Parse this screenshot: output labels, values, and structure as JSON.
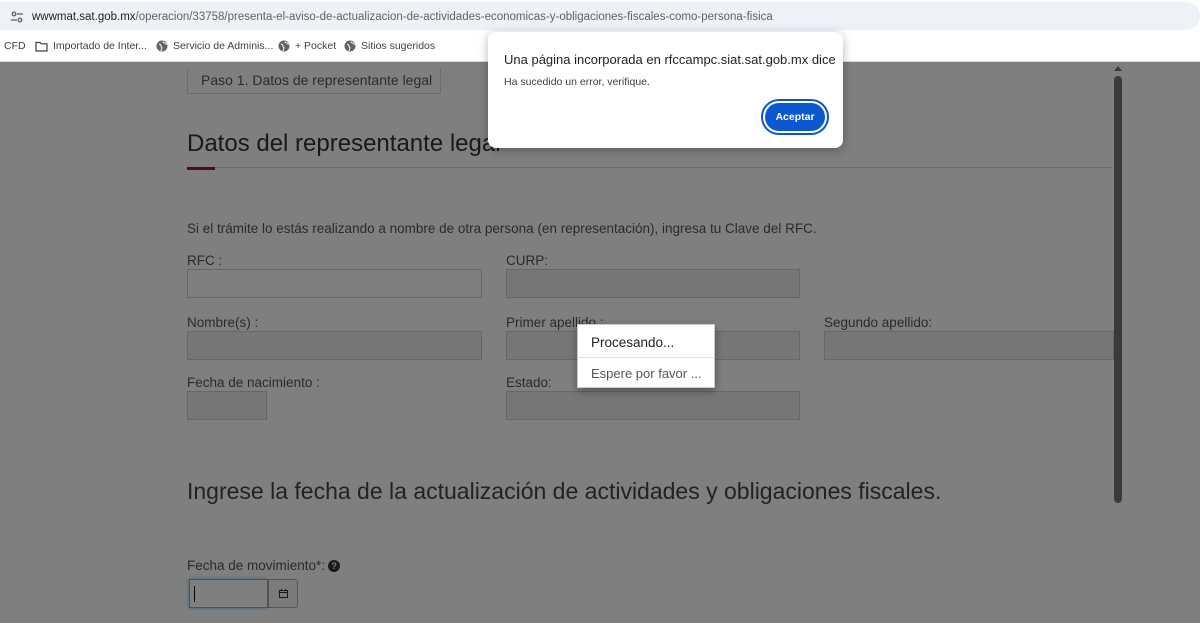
{
  "browser": {
    "url_domain": "wwwmat.sat.gob.mx",
    "url_path": "/operacion/33758/presenta-el-aviso-de-actualizacion-de-actividades-economicas-y-obligaciones-fiscales-como-persona-fisica",
    "bookmarks": [
      {
        "label": "CFD",
        "icon": "folder-icon"
      },
      {
        "label": "Importado de Inter...",
        "icon": "folder-icon"
      },
      {
        "label": "Servicio de Adminis...",
        "icon": "globe-icon"
      },
      {
        "label": "+ Pocket",
        "icon": "globe-icon"
      },
      {
        "label": "Sitios sugeridos",
        "icon": "globe-icon"
      }
    ]
  },
  "page": {
    "step_tab": "Paso 1. Datos de representante legal",
    "section_title": "Datos del representante legal",
    "intro": "Si el trámite lo estás realizando a nombre de otra persona (en representación), ingresa tu Clave del RFC.",
    "labels": {
      "rfc": "RFC :",
      "curp": "CURP:",
      "nombre": "Nombre(s) :",
      "primer_apellido": "Primer apellido :",
      "segundo_apellido": "Segundo apellido:",
      "fecha_nacimiento": "Fecha de nacimiento :",
      "estado": "Estado:"
    },
    "heading2": "Ingrese la fecha de la actualización de actividades y obligaciones fiscales.",
    "fecha_movimiento_label": "Fecha de movimiento*:",
    "help_glyph": "?"
  },
  "processing": {
    "title": "Procesando...",
    "message": "Espere por favor ..."
  },
  "dialog": {
    "title": "Una página incorporada en rfccampc.siat.sat.gob.mx dice",
    "message": "Ha sucedido un error, verifique.",
    "button": "Aceptar"
  },
  "colors": {
    "accent": "#a6192e",
    "dialog_button": "#0b57d0"
  }
}
